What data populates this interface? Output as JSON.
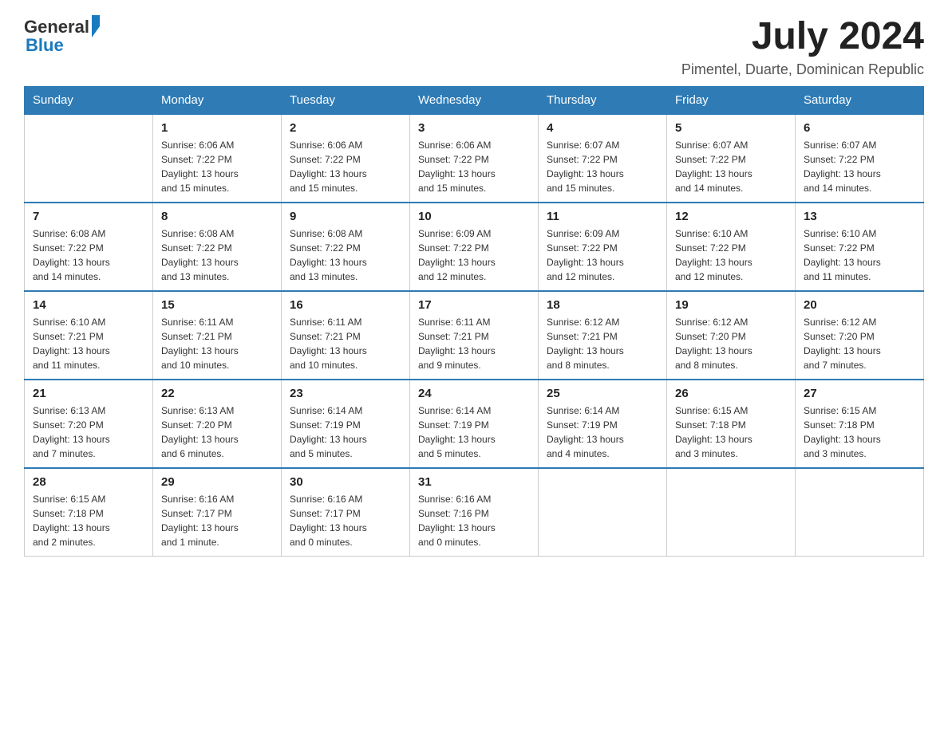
{
  "header": {
    "logo_general": "General",
    "logo_blue": "Blue",
    "month_year": "July 2024",
    "location": "Pimentel, Duarte, Dominican Republic"
  },
  "weekdays": [
    "Sunday",
    "Monday",
    "Tuesday",
    "Wednesday",
    "Thursday",
    "Friday",
    "Saturday"
  ],
  "weeks": [
    [
      {
        "day": "",
        "info": ""
      },
      {
        "day": "1",
        "info": "Sunrise: 6:06 AM\nSunset: 7:22 PM\nDaylight: 13 hours\nand 15 minutes."
      },
      {
        "day": "2",
        "info": "Sunrise: 6:06 AM\nSunset: 7:22 PM\nDaylight: 13 hours\nand 15 minutes."
      },
      {
        "day": "3",
        "info": "Sunrise: 6:06 AM\nSunset: 7:22 PM\nDaylight: 13 hours\nand 15 minutes."
      },
      {
        "day": "4",
        "info": "Sunrise: 6:07 AM\nSunset: 7:22 PM\nDaylight: 13 hours\nand 15 minutes."
      },
      {
        "day": "5",
        "info": "Sunrise: 6:07 AM\nSunset: 7:22 PM\nDaylight: 13 hours\nand 14 minutes."
      },
      {
        "day": "6",
        "info": "Sunrise: 6:07 AM\nSunset: 7:22 PM\nDaylight: 13 hours\nand 14 minutes."
      }
    ],
    [
      {
        "day": "7",
        "info": "Sunrise: 6:08 AM\nSunset: 7:22 PM\nDaylight: 13 hours\nand 14 minutes."
      },
      {
        "day": "8",
        "info": "Sunrise: 6:08 AM\nSunset: 7:22 PM\nDaylight: 13 hours\nand 13 minutes."
      },
      {
        "day": "9",
        "info": "Sunrise: 6:08 AM\nSunset: 7:22 PM\nDaylight: 13 hours\nand 13 minutes."
      },
      {
        "day": "10",
        "info": "Sunrise: 6:09 AM\nSunset: 7:22 PM\nDaylight: 13 hours\nand 12 minutes."
      },
      {
        "day": "11",
        "info": "Sunrise: 6:09 AM\nSunset: 7:22 PM\nDaylight: 13 hours\nand 12 minutes."
      },
      {
        "day": "12",
        "info": "Sunrise: 6:10 AM\nSunset: 7:22 PM\nDaylight: 13 hours\nand 12 minutes."
      },
      {
        "day": "13",
        "info": "Sunrise: 6:10 AM\nSunset: 7:22 PM\nDaylight: 13 hours\nand 11 minutes."
      }
    ],
    [
      {
        "day": "14",
        "info": "Sunrise: 6:10 AM\nSunset: 7:21 PM\nDaylight: 13 hours\nand 11 minutes."
      },
      {
        "day": "15",
        "info": "Sunrise: 6:11 AM\nSunset: 7:21 PM\nDaylight: 13 hours\nand 10 minutes."
      },
      {
        "day": "16",
        "info": "Sunrise: 6:11 AM\nSunset: 7:21 PM\nDaylight: 13 hours\nand 10 minutes."
      },
      {
        "day": "17",
        "info": "Sunrise: 6:11 AM\nSunset: 7:21 PM\nDaylight: 13 hours\nand 9 minutes."
      },
      {
        "day": "18",
        "info": "Sunrise: 6:12 AM\nSunset: 7:21 PM\nDaylight: 13 hours\nand 8 minutes."
      },
      {
        "day": "19",
        "info": "Sunrise: 6:12 AM\nSunset: 7:20 PM\nDaylight: 13 hours\nand 8 minutes."
      },
      {
        "day": "20",
        "info": "Sunrise: 6:12 AM\nSunset: 7:20 PM\nDaylight: 13 hours\nand 7 minutes."
      }
    ],
    [
      {
        "day": "21",
        "info": "Sunrise: 6:13 AM\nSunset: 7:20 PM\nDaylight: 13 hours\nand 7 minutes."
      },
      {
        "day": "22",
        "info": "Sunrise: 6:13 AM\nSunset: 7:20 PM\nDaylight: 13 hours\nand 6 minutes."
      },
      {
        "day": "23",
        "info": "Sunrise: 6:14 AM\nSunset: 7:19 PM\nDaylight: 13 hours\nand 5 minutes."
      },
      {
        "day": "24",
        "info": "Sunrise: 6:14 AM\nSunset: 7:19 PM\nDaylight: 13 hours\nand 5 minutes."
      },
      {
        "day": "25",
        "info": "Sunrise: 6:14 AM\nSunset: 7:19 PM\nDaylight: 13 hours\nand 4 minutes."
      },
      {
        "day": "26",
        "info": "Sunrise: 6:15 AM\nSunset: 7:18 PM\nDaylight: 13 hours\nand 3 minutes."
      },
      {
        "day": "27",
        "info": "Sunrise: 6:15 AM\nSunset: 7:18 PM\nDaylight: 13 hours\nand 3 minutes."
      }
    ],
    [
      {
        "day": "28",
        "info": "Sunrise: 6:15 AM\nSunset: 7:18 PM\nDaylight: 13 hours\nand 2 minutes."
      },
      {
        "day": "29",
        "info": "Sunrise: 6:16 AM\nSunset: 7:17 PM\nDaylight: 13 hours\nand 1 minute."
      },
      {
        "day": "30",
        "info": "Sunrise: 6:16 AM\nSunset: 7:17 PM\nDaylight: 13 hours\nand 0 minutes."
      },
      {
        "day": "31",
        "info": "Sunrise: 6:16 AM\nSunset: 7:16 PM\nDaylight: 13 hours\nand 0 minutes."
      },
      {
        "day": "",
        "info": ""
      },
      {
        "day": "",
        "info": ""
      },
      {
        "day": "",
        "info": ""
      }
    ]
  ]
}
